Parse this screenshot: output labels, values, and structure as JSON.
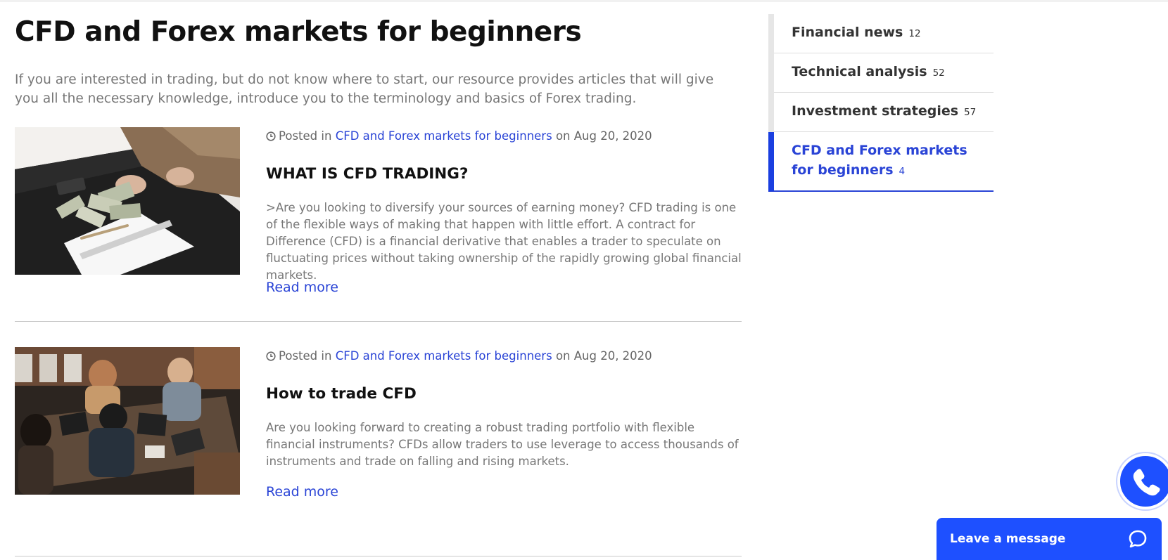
{
  "page": {
    "title": "CFD and Forex markets for beginners",
    "intro": "If you are interested in trading, but do not know where to start, our resource provides articles that will give you all the necessary knowledge, introduce you to the terminology and basics of Forex trading."
  },
  "posts": [
    {
      "posted_in": "Posted in",
      "category": "CFD and Forex markets for beginners",
      "on": "on Aug 20, 2020",
      "title": "WHAT IS CFD TRADING?",
      "excerpt": ">Are you looking to diversify your sources of earning money? CFD trading is one of the flexible ways of making that happen with little effort. A contract for Difference (CFD) is a financial derivative that enables a trader to speculate on fluctuating prices without taking ownership of the rapidly growing global financial markets.",
      "read_more": "Read more"
    },
    {
      "posted_in": "Posted in",
      "category": "CFD and Forex markets for beginners",
      "on": "on Aug 20, 2020",
      "title": "How to trade CFD",
      "excerpt": "Are you looking forward to creating a robust trading portfolio with flexible financial instruments? CFDs allow traders to use leverage to access thousands of instruments and trade on falling and rising markets.",
      "read_more": "Read more"
    }
  ],
  "sidebar": {
    "categories": [
      {
        "label": "Financial news",
        "count": "12"
      },
      {
        "label": "Technical analysis",
        "count": "52"
      },
      {
        "label": "Investment strategies",
        "count": "57"
      },
      {
        "label": "CFD and Forex markets for beginners",
        "count": "4"
      }
    ]
  },
  "chat": {
    "label": "Leave a message"
  },
  "colors": {
    "accent": "#2a44d6",
    "widget": "#1e50ff"
  }
}
